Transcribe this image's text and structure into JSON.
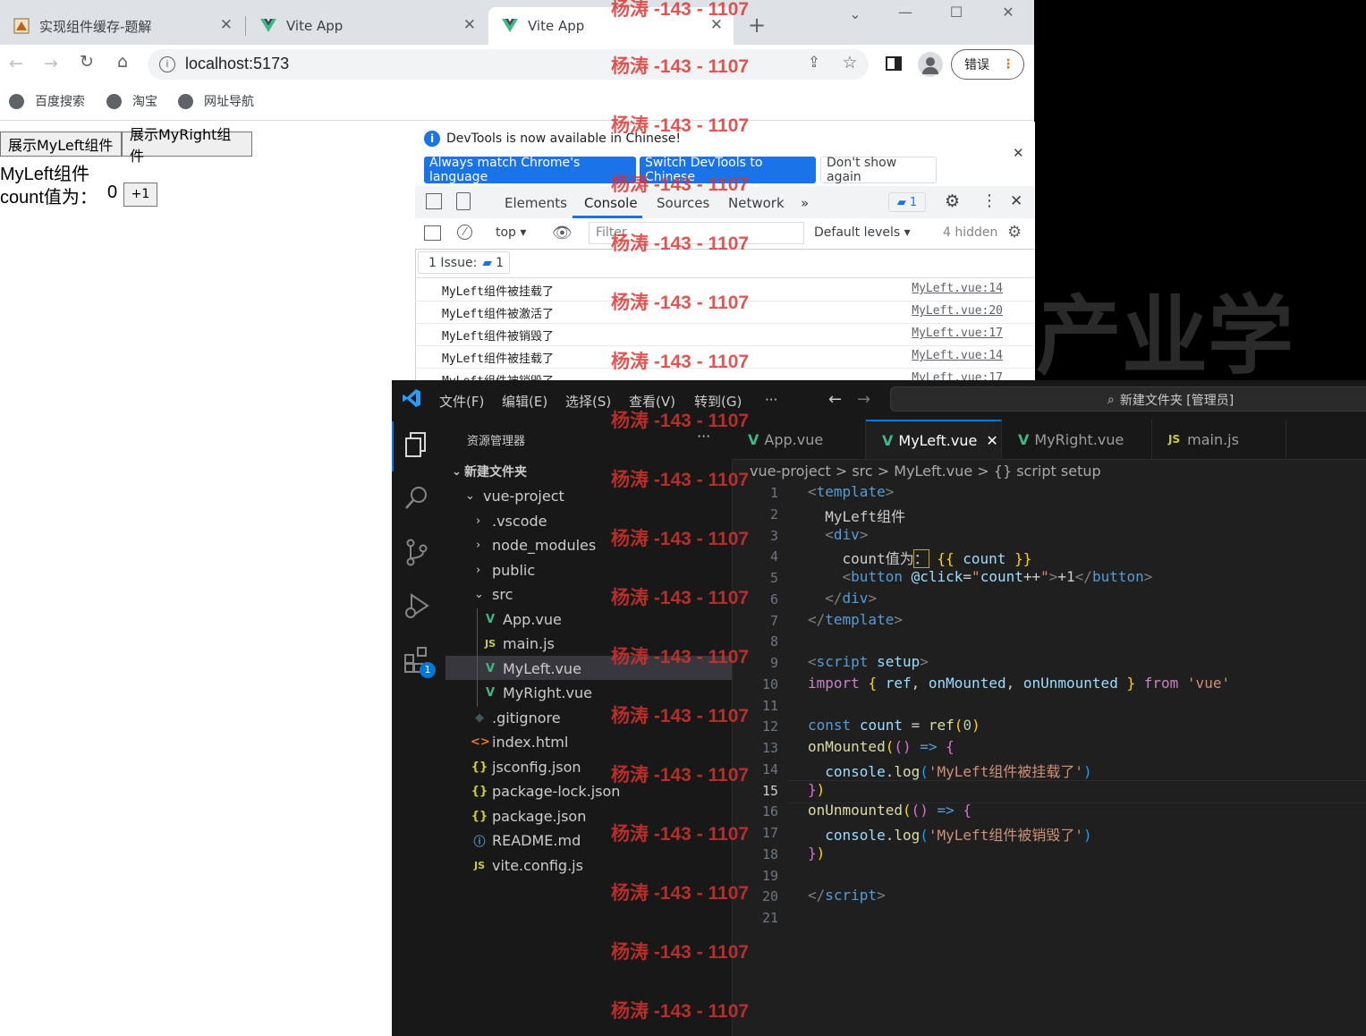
{
  "browser": {
    "tabs": [
      {
        "title": "实现组件缓存-题解"
      },
      {
        "title": "Vite App"
      },
      {
        "title": "Vite App"
      }
    ],
    "url": "localhost:5173",
    "error_button": "错误",
    "bookmarks": [
      "百度搜索",
      "淘宝",
      "网址导航"
    ]
  },
  "page": {
    "btn_left": "展示MyLeft组件",
    "btn_right": "展示MyRight组件",
    "component_title": "MyLeft组件",
    "count_label": "count值为：",
    "count_value": "0",
    "inc_button": "+1"
  },
  "devtools": {
    "info_text": "DevTools is now available in Chinese!",
    "btn_match": "Always match Chrome's language",
    "btn_switch": "Switch DevTools to Chinese",
    "btn_dont_show": "Don't show again",
    "tabs": [
      "Elements",
      "Console",
      "Sources",
      "Network"
    ],
    "issues_badge": "1",
    "context": "top",
    "filter_placeholder": "Filter",
    "levels": "Default levels",
    "hidden": "4 hidden",
    "issue_label": "1 Issue:",
    "issue_count": "1",
    "logs": [
      {
        "msg": "MyLeft组件被挂载了",
        "src": "MyLeft.vue:14"
      },
      {
        "msg": "MyLeft组件被激活了",
        "src": "MyLeft.vue:20"
      },
      {
        "msg": "MyLeft组件被销毁了",
        "src": "MyLeft.vue:17"
      },
      {
        "msg": "MyLeft组件被挂载了",
        "src": "MyLeft.vue:14"
      },
      {
        "msg": "MyLeft组件被销毁了",
        "src": "MyLeft.vue:17"
      }
    ]
  },
  "vscode": {
    "menu": [
      "文件(F)",
      "编辑(E)",
      "选择(S)",
      "查看(V)",
      "转到(G)",
      "···"
    ],
    "search": "新建文件夹 [管理员]",
    "explorer_title": "资源管理器",
    "extensions_badge": "1",
    "tree": [
      {
        "label": "新建文件夹"
      },
      {
        "label": "vue-project"
      },
      {
        "label": ".vscode"
      },
      {
        "label": "node_modules"
      },
      {
        "label": "public"
      },
      {
        "label": "src"
      },
      {
        "label": "App.vue"
      },
      {
        "label": "main.js"
      },
      {
        "label": "MyLeft.vue"
      },
      {
        "label": "MyRight.vue"
      },
      {
        "label": ".gitignore"
      },
      {
        "label": "index.html"
      },
      {
        "label": "jsconfig.json"
      },
      {
        "label": "package-lock.json"
      },
      {
        "label": "package.json"
      },
      {
        "label": "README.md"
      },
      {
        "label": "vite.config.js"
      }
    ],
    "editor_tabs": [
      "App.vue",
      "MyLeft.vue",
      "MyRight.vue",
      "main.js"
    ],
    "breadcrumb": "vue-project > src > MyLeft.vue > {} script setup",
    "line_numbers": [
      "1",
      "2",
      "3",
      "4",
      "5",
      "6",
      "7",
      "8",
      "9",
      "10",
      "11",
      "12",
      "13",
      "14",
      "15",
      "16",
      "17",
      "18",
      "19",
      "20",
      "21"
    ]
  },
  "watermark": "杨涛 -143 - 1107",
  "background_text": "产业学",
  "colors": {
    "vue_green": "#41b883",
    "vscode_blue": "#0078d4",
    "devtools_blue": "#1a73e8",
    "watermark_red": "#d9332f"
  }
}
